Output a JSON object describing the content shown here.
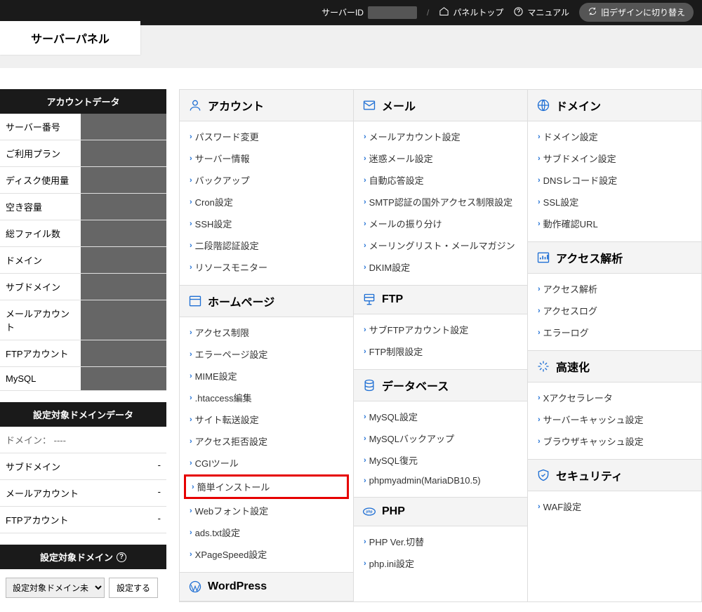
{
  "topbar": {
    "serveridLabel": "サーバーID",
    "panelTop": "パネルトップ",
    "manual": "マニュアル",
    "switchDesign": "旧デザインに切り替え"
  },
  "headerTitle": "サーバーパネル",
  "account": {
    "header": "アカウントデータ",
    "rows": [
      {
        "k": "サーバー番号",
        "v": ""
      },
      {
        "k": "ご利用プラン",
        "v": ""
      },
      {
        "k": "ディスク使用量",
        "v": ""
      },
      {
        "k": "空き容量",
        "v": ""
      },
      {
        "k": "総ファイル数",
        "v": ""
      },
      {
        "k": "ドメイン",
        "v": ""
      },
      {
        "k": "サブドメイン",
        "v": ""
      },
      {
        "k": "メールアカウント",
        "v": ""
      },
      {
        "k": "FTPアカウント",
        "v": ""
      },
      {
        "k": "MySQL",
        "v": ""
      }
    ]
  },
  "domainData": {
    "header": "設定対象ドメインデータ",
    "line": "ドメイン：  ----",
    "rows": [
      [
        "サブドメイン",
        "-"
      ],
      [
        "メールアカウント",
        "-"
      ],
      [
        "FTPアカウント",
        "-"
      ]
    ]
  },
  "targetDomain": {
    "header": "設定対象ドメイン",
    "option": "設定対象ドメイン未",
    "btn": "設定する"
  },
  "cols": [
    [
      {
        "title": "アカウント",
        "icon": "user",
        "items": [
          "パスワード変更",
          "サーバー情報",
          "バックアップ",
          "Cron設定",
          "SSH設定",
          "二段階認証設定",
          "リソースモニター"
        ]
      },
      {
        "title": "ホームページ",
        "icon": "window",
        "items": [
          "アクセス制限",
          "エラーページ設定",
          "MIME設定",
          ".htaccess編集",
          "サイト転送設定",
          "アクセス拒否設定",
          "CGIツール",
          {
            "t": "簡単インストール",
            "hl": true
          },
          "Webフォント設定",
          "ads.txt設定",
          "XPageSpeed設定"
        ]
      },
      {
        "title": "WordPress",
        "icon": "wp",
        "items": []
      }
    ],
    [
      {
        "title": "メール",
        "icon": "mail",
        "items": [
          "メールアカウント設定",
          "迷惑メール設定",
          "自動応答設定",
          "SMTP認証の国外アクセス制限設定",
          "メールの振り分け",
          "メーリングリスト・メールマガジン",
          "DKIM設定"
        ]
      },
      {
        "title": "FTP",
        "icon": "ftp",
        "items": [
          "サブFTPアカウント設定",
          "FTP制限設定"
        ]
      },
      {
        "title": "データベース",
        "icon": "db",
        "items": [
          "MySQL設定",
          "MySQLバックアップ",
          "MySQL復元",
          "phpmyadmin(MariaDB10.5)"
        ]
      },
      {
        "title": "PHP",
        "icon": "php",
        "items": [
          "PHP Ver.切替",
          "php.ini設定"
        ]
      }
    ],
    [
      {
        "title": "ドメイン",
        "icon": "globe",
        "items": [
          "ドメイン設定",
          "サブドメイン設定",
          "DNSレコード設定",
          "SSL設定",
          "動作確認URL"
        ]
      },
      {
        "title": "アクセス解析",
        "icon": "chart",
        "items": [
          "アクセス解析",
          "アクセスログ",
          "エラーログ"
        ]
      },
      {
        "title": "高速化",
        "icon": "speed",
        "items": [
          "Xアクセラレータ",
          "サーバーキャッシュ設定",
          "ブラウザキャッシュ設定"
        ]
      },
      {
        "title": "セキュリティ",
        "icon": "shield",
        "items": [
          "WAF設定"
        ]
      }
    ]
  ]
}
